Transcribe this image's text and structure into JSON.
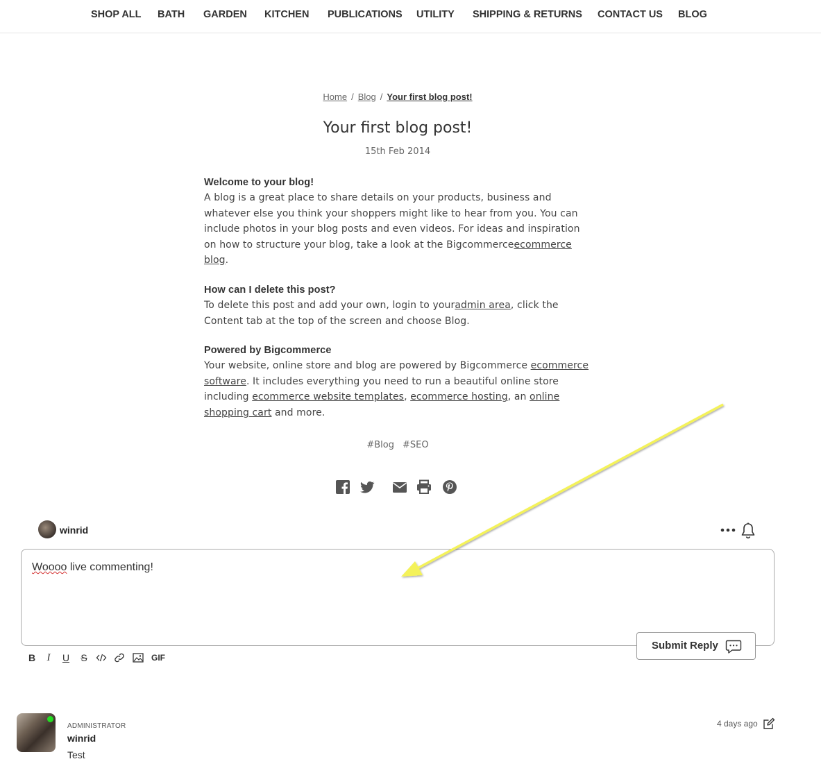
{
  "nav": {
    "items": [
      {
        "label": "SHOP ALL"
      },
      {
        "label": "BATH"
      },
      {
        "label": "GARDEN"
      },
      {
        "label": "KITCHEN"
      },
      {
        "label": "PUBLICATIONS"
      },
      {
        "label": "UTILITY"
      },
      {
        "label": "SHIPPING & RETURNS"
      },
      {
        "label": "CONTACT US"
      },
      {
        "label": "BLOG"
      }
    ]
  },
  "breadcrumb": {
    "home": "Home",
    "blog": "Blog",
    "current": "Your first blog post!",
    "separator": "/"
  },
  "post": {
    "title": "Your first blog post!",
    "date": "15th Feb 2014",
    "sections": [
      {
        "heading": "Welcome to your blog!",
        "text_before": "A blog is a great place to share details on your products, business and whatever else you think your shoppers might like to hear from you. You can include photos in your blog posts and even videos. For ideas and inspiration on how to structure your blog, take a look at the Bigcommerce",
        "link": "ecommerce blog",
        "text_after": "."
      },
      {
        "heading": "How can I delete this post?",
        "text_before": "To delete this post and add your own, login to your",
        "link": "admin area",
        "text_after": ", click the Content tab at the top of the screen and choose Blog."
      },
      {
        "heading": "Powered by Bigcommerce",
        "text_1": "Your website, online store and blog are powered by Bigcommerce ",
        "link_1": "ecommerce software",
        "text_2": ". It includes everything you need to run a beautiful online store including ",
        "link_2": "ecommerce website templates",
        "text_3": ", ",
        "link_3": "ecommerce hosting",
        "text_4": ", an ",
        "link_4": "online shopping cart",
        "text_5": " and more."
      }
    ],
    "tags": [
      "#Blog",
      "#SEO"
    ]
  },
  "share": {
    "icons": [
      "facebook-icon",
      "twitter-icon",
      "email-icon",
      "print-icon",
      "pinterest-icon"
    ]
  },
  "composer": {
    "username": "winrid",
    "text_misspelled": "Woooo",
    "text_rest": " live commenting!",
    "submit_label": "Submit Reply",
    "toolbar": {
      "bold": "B",
      "italic": "I",
      "underline": "U",
      "strike": "S",
      "gif": "GIF"
    }
  },
  "comment": {
    "role": "ADMINISTRATOR",
    "author": "winrid",
    "text": "Test",
    "time": "4 days ago",
    "online": true
  },
  "colors": {
    "annotation_arrow": "#f4f25a",
    "online": "#22dd22",
    "spellcheck": "#d32f2f"
  }
}
